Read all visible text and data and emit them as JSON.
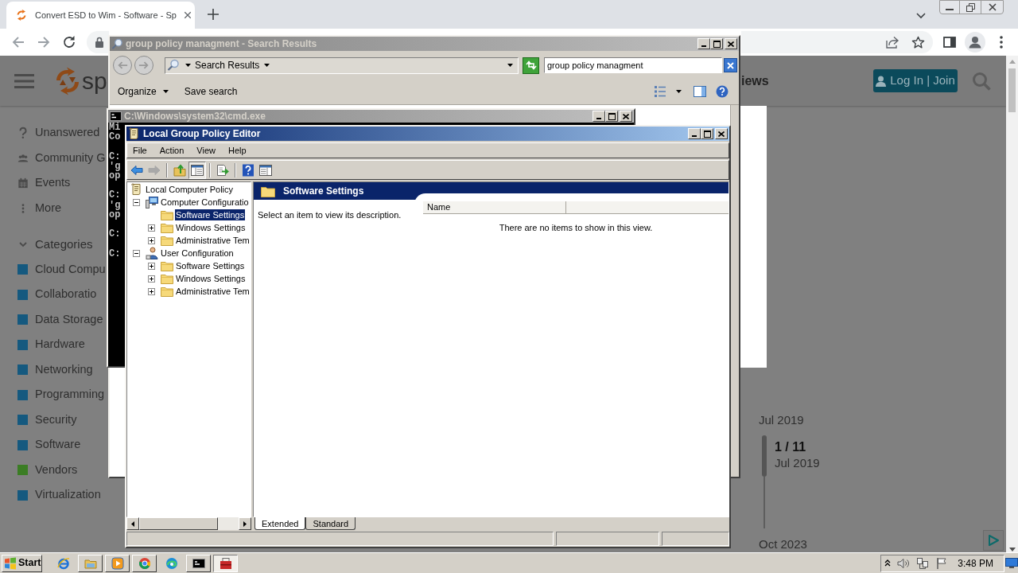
{
  "browser": {
    "tabs": [
      {
        "title": "Convert ESD to Wim - Software - Sp",
        "selected": true
      }
    ],
    "nav": [
      {
        "kind": "back",
        "disabled": true
      },
      {
        "kind": "forward",
        "disabled": true
      },
      {
        "kind": "reload",
        "disabled": false
      }
    ]
  },
  "page": {
    "logo_text": "sp",
    "nav_partial": "iews",
    "login_button": "Log In | Join",
    "sidebar": [
      {
        "label": "Unanswered",
        "kind": "question"
      },
      {
        "label": "Community G",
        "kind": "community"
      },
      {
        "label": "Events",
        "kind": "events"
      },
      {
        "label": "More",
        "kind": "more"
      }
    ],
    "categories": {
      "heading": "Categories",
      "expanded": true,
      "items": [
        {
          "label": "Cloud Compu",
          "color": "#15597f"
        },
        {
          "label": "Collaboratio",
          "color": "#15597f"
        },
        {
          "label": "Data Storage",
          "color": "#15597f"
        },
        {
          "label": "Hardware",
          "color": "#15597f"
        },
        {
          "label": "Networking",
          "color": "#15597f"
        },
        {
          "label": "Programming",
          "color": "#15597f"
        },
        {
          "label": "Security",
          "color": "#15597f"
        },
        {
          "label": "Software",
          "color": "#15597f"
        },
        {
          "label": "Vendors",
          "color": "#3b7d24"
        },
        {
          "label": "Virtualization",
          "color": "#15597f"
        }
      ]
    },
    "timeline": {
      "start": "Jul 2019",
      "position": "1 / 11",
      "position_date": "Jul 2019",
      "end": "Oct 2023"
    }
  },
  "explorer_window": {
    "title": "group policy managment - Search Results",
    "active": false,
    "nav_buttons": [
      {
        "kind": "back",
        "disabled": true
      },
      {
        "kind": "forward",
        "disabled": true
      }
    ],
    "location": "Search Results",
    "search_value": "group policy managment",
    "toolbar": [
      {
        "label": "Organize",
        "has_menu": true
      },
      {
        "label": "Save search",
        "has_menu": false
      }
    ]
  },
  "cmd_window": {
    "title": "C:\\Windows\\system32\\cmd.exe",
    "active": false,
    "blocks": [
      [
        "Mi",
        "Co"
      ],
      [
        "C:",
        "'g",
        "op"
      ],
      [
        "C:",
        "'g",
        "op"
      ],
      [
        "C:"
      ],
      [
        "C:"
      ]
    ]
  },
  "gpe_window": {
    "title": "Local Group Policy Editor",
    "active": true,
    "menu": [
      "File",
      "Action",
      "View",
      "Help"
    ],
    "toolbar": [
      [
        {
          "kind": "back",
          "disabled": false,
          "pressed": false
        },
        {
          "kind": "forward",
          "disabled": true,
          "pressed": false
        }
      ],
      [
        {
          "kind": "up",
          "disabled": false,
          "pressed": false
        },
        {
          "kind": "tree_toggle",
          "disabled": false,
          "pressed": true
        }
      ],
      [
        {
          "kind": "export",
          "disabled": false,
          "pressed": false
        }
      ],
      [
        {
          "kind": "help",
          "disabled": false,
          "pressed": false
        },
        {
          "kind": "panes",
          "disabled": false,
          "pressed": false
        }
      ]
    ],
    "tree": [
      {
        "label": "Local Computer Policy",
        "kind": "policy",
        "has_expander": false,
        "selected": false,
        "children": [
          {
            "label": "Computer Configuratio",
            "kind": "computer",
            "has_expander": true,
            "expanded": true,
            "selected": false,
            "children": [
              {
                "label": "Software Settings",
                "kind": "folder",
                "has_expander": false,
                "selected": true
              },
              {
                "label": "Windows Settings",
                "kind": "folder",
                "has_expander": true,
                "selected": false
              },
              {
                "label": "Administrative Tem",
                "kind": "folder",
                "has_expander": true,
                "selected": false
              }
            ]
          },
          {
            "label": "User Configuration",
            "kind": "user",
            "has_expander": true,
            "expanded": true,
            "selected": false,
            "children": [
              {
                "label": "Software Settings",
                "kind": "folder",
                "has_expander": true,
                "selected": false
              },
              {
                "label": "Windows Settings",
                "kind": "folder",
                "has_expander": true,
                "selected": false
              },
              {
                "label": "Administrative Tem",
                "kind": "folder",
                "has_expander": true,
                "selected": false
              }
            ]
          }
        ]
      }
    ],
    "pane_title": "Software Settings",
    "description": "Select an item to view its description.",
    "columns": [
      "Name"
    ],
    "empty_message": "There are no items to show in this view.",
    "view_tabs": [
      {
        "label": "Extended",
        "selected": true
      },
      {
        "label": "Standard",
        "selected": false
      }
    ]
  },
  "taskbar": {
    "start": "Start",
    "apps": [
      {
        "kind": "ie",
        "running": false,
        "selected": false
      },
      {
        "kind": "explorer",
        "running": true,
        "selected": false
      },
      {
        "kind": "media",
        "running": true,
        "selected": false
      },
      {
        "kind": "chrome",
        "running": true,
        "selected": false
      },
      {
        "kind": "edge",
        "running": false,
        "selected": false
      },
      {
        "kind": "cmd",
        "running": true,
        "selected": false
      },
      {
        "kind": "gpe",
        "running": true,
        "selected": true
      }
    ],
    "clock": "3:48 PM"
  }
}
